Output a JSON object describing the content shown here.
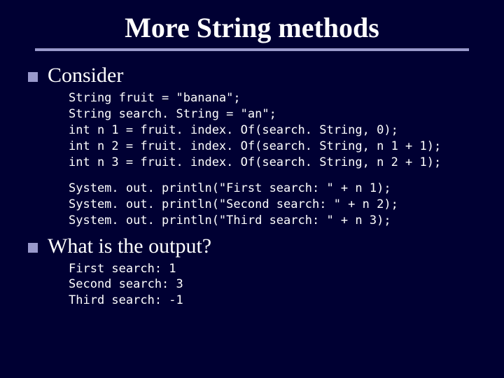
{
  "title": "More String methods",
  "sections": [
    {
      "heading": "Consider",
      "code1": "String fruit = \"banana\";\nString search. String = \"an\";\nint n 1 = fruit. index. Of(search. String, 0);\nint n 2 = fruit. index. Of(search. String, n 1 + 1);\nint n 3 = fruit. index. Of(search. String, n 2 + 1);",
      "code2": "System. out. println(\"First search: \" + n 1);\nSystem. out. println(\"Second search: \" + n 2);\nSystem. out. println(\"Third search: \" + n 3);"
    },
    {
      "heading": "What is the output?",
      "code1": "First search: 1\nSecond search: 3\nThird search: -1"
    }
  ]
}
